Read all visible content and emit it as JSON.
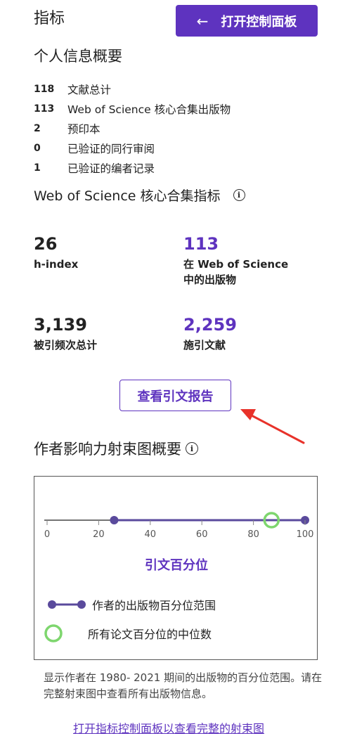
{
  "header": {
    "title": "指标",
    "open_dashboard_label": "打开控制面板"
  },
  "profile_summary": {
    "heading": "个人信息概要",
    "rows": [
      {
        "count": "118",
        "label": "文献总计"
      },
      {
        "count": "113",
        "label": "Web of Science 核心合集出版物"
      },
      {
        "count": "2",
        "label": "预印本"
      },
      {
        "count": "0",
        "label": "已验证的同行审阅"
      },
      {
        "count": "1",
        "label": "已验证的编者记录"
      }
    ]
  },
  "wos_metrics": {
    "heading": "Web of Science 核心合集指标",
    "h_index": {
      "value": "26",
      "label": "h-index"
    },
    "publications": {
      "value": "113",
      "label_line1": "在 Web of Science",
      "label_line2": "中的出版物"
    },
    "times_cited": {
      "value": "3,139",
      "label": "被引频次总计"
    },
    "citing_articles": {
      "value": "2,259",
      "label": "施引文献"
    },
    "citation_report_label": "查看引文报告"
  },
  "beamplot": {
    "heading": "作者影响力射束图概要",
    "axis_ticks": [
      "0",
      "20",
      "40",
      "60",
      "80",
      "100"
    ],
    "axis_label": "引文百分位",
    "author_range_min": 26,
    "author_range_max": 100,
    "median_percentile": 87,
    "legend_range": "作者的出版物百分位范围",
    "legend_median": "所有论文百分位的中位数",
    "note": "显示作者在 1980- 2021 期间的出版物的百分位范围。请在完整射束图中查看所有出版物信息。",
    "full_link": "打开指标控制面板以查看完整的射束图",
    "colors": {
      "range": "#5a4a9c",
      "median": "#7ed66e"
    }
  }
}
